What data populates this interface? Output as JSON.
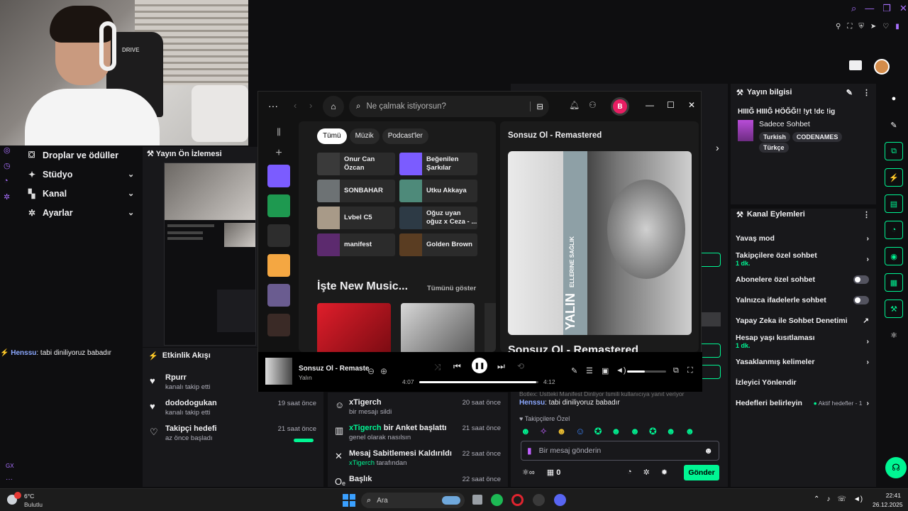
{
  "webcam": {
    "chair_text": "DRIVE"
  },
  "leftnav": {
    "items": [
      {
        "label": "Droplar ve ödüller",
        "icon": "gift-icon",
        "chevron": false
      },
      {
        "label": "Stüdyo",
        "icon": "studio-icon",
        "chevron": true
      },
      {
        "label": "Kanal",
        "icon": "channel-icon",
        "chevron": true
      },
      {
        "label": "Ayarlar",
        "icon": "gear-icon",
        "chevron": true
      }
    ],
    "bottom_label": "GX"
  },
  "preview": {
    "title": "Yayın Ön İzlemesi"
  },
  "left_chat": {
    "user": "Henssu",
    "text": ": tabi diniliyoruz babadır"
  },
  "activity": {
    "title": "Etkinlik Akışı",
    "items": [
      {
        "name": "Rpurr",
        "desc": "kanalı takip etti",
        "time": ""
      },
      {
        "name": "dododogukan",
        "desc": "kanalı takip etti",
        "time": "19 saat önce"
      },
      {
        "name": "Takipçi hedefi",
        "desc": "az önce başladı",
        "time": "21 saat önce"
      }
    ]
  },
  "midfeed": {
    "items": [
      {
        "title": "xTigerch",
        "title_rest": "",
        "desc": "bir mesajı sildi",
        "desc_green": "",
        "time": "20 saat önce"
      },
      {
        "title": "xTigerch",
        "title_rest": " bir Anket başlattı",
        "desc": "genel olarak nasılsın",
        "desc_green": "",
        "time": "21 saat önce"
      },
      {
        "title": "Mesaj Sabitlemesi Kaldırıldı",
        "title_rest": "",
        "desc": " tarafından",
        "desc_green": "xTigerch",
        "time": "22 saat önce"
      },
      {
        "title": "Başlık",
        "title_rest": "",
        "desc": "",
        "desc_green": "",
        "time": "22 saat önce"
      }
    ]
  },
  "chat": {
    "bot_line": "Botlex: Üstteki Manifest Dinliyor  İsmili kullanıcıya yanıt veriyor",
    "user": "Henssu",
    "msg": ": tabi diniliyoruz babadır",
    "followers_label": "Takipçilere Özel",
    "input_placeholder": "Bir mesaj gönderin",
    "points": "0",
    "send": "Gönder"
  },
  "stream_info": {
    "title": "Yayın bilgisi",
    "stream_title": "HIIIĞ HIIIĞ HÖĞĞ!! !yt !dc !ig",
    "category": "Sadece Sohbet",
    "tags": [
      "Turkish",
      "CODENAMES",
      "Türkçe"
    ]
  },
  "channel_actions": {
    "title": "Kanal Eylemleri",
    "rows": [
      {
        "label": "Yavaş mod",
        "sub": "",
        "kind": "chevron"
      },
      {
        "label": "Takipçilere özel sohbet",
        "sub": "1 dk.",
        "kind": "chevron"
      },
      {
        "label": "Abonelere özel sohbet",
        "sub": "",
        "kind": "toggle"
      },
      {
        "label": "Yalnızca ifadelerle sohbet",
        "sub": "",
        "kind": "toggle"
      },
      {
        "label": "Yapay Zeka ile Sohbet Denetimi",
        "sub": "",
        "kind": "external"
      },
      {
        "label": "Hesap yaşı kısıtlaması",
        "sub": "1 dk.",
        "kind": "chevron"
      },
      {
        "label": "Yasaklanmış kelimeler",
        "sub": "",
        "kind": "chevron"
      },
      {
        "label": "İzleyici Yönlendir",
        "sub": "",
        "kind": "none"
      },
      {
        "label": "Hedefleri belirleyin",
        "sub": "",
        "kind": "goal",
        "extra": "Aktif hedefler - 1"
      }
    ]
  },
  "spotify": {
    "search_placeholder": "Ne çalmak istiyorsun?",
    "avatar_letter": "B",
    "chips": [
      "Tümü",
      "Müzik",
      "Podcast'ler"
    ],
    "quick": [
      {
        "label": "Onur Can Özcan",
        "color": "#3a3a3a"
      },
      {
        "label": "Beğenilen Şarkılar",
        "color": "#7b5cff"
      },
      {
        "label": "SONBAHAR",
        "color": "#6d7274"
      },
      {
        "label": "Utku Akkaya",
        "color": "#4e8a7a"
      },
      {
        "label": "Lvbel C5",
        "color": "#a89a88"
      },
      {
        "label": "Oğuz uyan oğuz x Ceza - ...",
        "color": "#2d3a45"
      },
      {
        "label": "manifest",
        "color": "#5c2a6e"
      },
      {
        "label": "Golden Brown",
        "color": "#5a3d22"
      }
    ],
    "section_title": "İşte New Music...",
    "show_all": "Tümünü göster",
    "np_header": "Sonsuz Ol - Remastered",
    "np_title_big": "Sonsuz Ol - Remastered",
    "album_vertical": "ELLERINE SAĞLIK",
    "album_artist_stylized": "YALIN",
    "track": "Sonsuz Ol - Remaste",
    "artist": "Yalın",
    "elapsed": "4:07",
    "duration": "4:12",
    "progress": 0.98,
    "volume": 0.45
  },
  "taskbar": {
    "weather_temp": "6°C",
    "weather_desc": "Bulutlu",
    "search": "Ara",
    "time": "22:41",
    "date": "26.12.2025"
  }
}
